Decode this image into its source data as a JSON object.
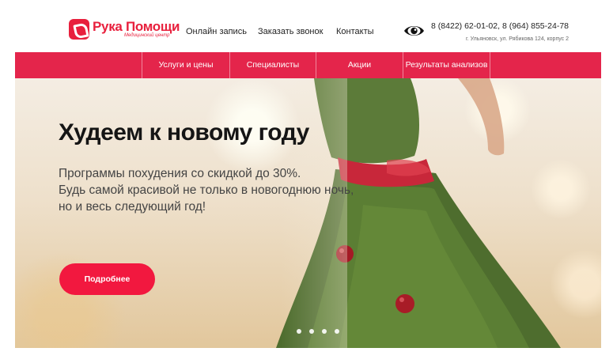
{
  "header": {
    "logo": {
      "title": "Рука Помощи",
      "subtitle": "Медицинский центр",
      "brand_color": "#e8203d"
    },
    "nav": [
      {
        "label": "Онлайн запись"
      },
      {
        "label": "Заказать звонок"
      },
      {
        "label": "Контакты"
      }
    ],
    "accessibility_icon": "eye-icon",
    "phones": "8 (8422) 62-01-02, 8 (964) 855-24-78",
    "address": "г. Ульяновск, ул. Рябикова 124, корпус 2"
  },
  "menu": {
    "color": "#e4254b",
    "items": [
      {
        "label": "Услуги и цены"
      },
      {
        "label": "Специалисты"
      },
      {
        "label": "Акции"
      },
      {
        "label": "Результаты анализов"
      }
    ]
  },
  "hero": {
    "title": "Худеем к новому году",
    "text_lines": [
      "Программы похудения со скидкой до 30%.",
      "Будь самой красивой не только в новогоднюю ночь,",
      "но и весь следующий год!"
    ],
    "button_label": "Подробнее",
    "button_color": "#f2183f",
    "slides_count": 4
  }
}
